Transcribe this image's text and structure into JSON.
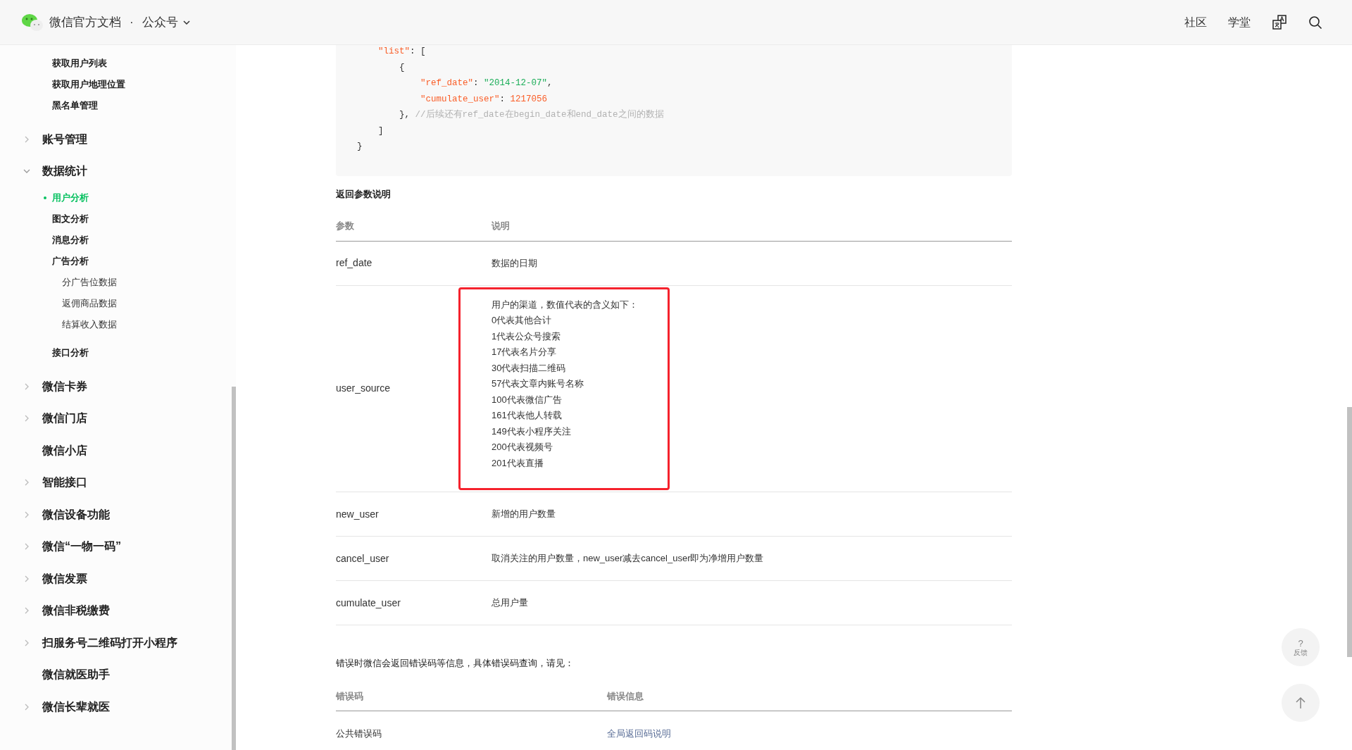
{
  "header": {
    "title": "微信官方文档",
    "separator": "·",
    "section": "公众号",
    "nav": [
      {
        "kind": "text",
        "label": "社区"
      },
      {
        "kind": "text",
        "label": "学堂"
      },
      {
        "kind": "translate"
      },
      {
        "kind": "search"
      }
    ]
  },
  "sidebar": {
    "items": [
      {
        "kind": "continued",
        "children": [
          {
            "label": "获取用户列表",
            "selected": false
          },
          {
            "label": "获取用户地理位置",
            "selected": false
          },
          {
            "label": "黑名单管理",
            "selected": false
          }
        ]
      },
      {
        "kind": "group",
        "label": "账号管理",
        "expanded": false
      },
      {
        "kind": "group",
        "label": "数据统计",
        "expanded": true,
        "children": [
          {
            "label": "用户分析",
            "selected": true
          },
          {
            "label": "图文分析",
            "selected": false
          },
          {
            "label": "消息分析",
            "selected": false
          },
          {
            "label": "广告分析",
            "selected": false,
            "children": [
              {
                "label": "分广告位数据"
              },
              {
                "label": "返佣商品数据"
              },
              {
                "label": "结算收入数据"
              }
            ]
          },
          {
            "label": "接口分析",
            "selected": false
          }
        ]
      },
      {
        "kind": "group",
        "label": "微信卡券",
        "expanded": false
      },
      {
        "kind": "group",
        "label": "微信门店",
        "expanded": false
      },
      {
        "kind": "link",
        "label": "微信小店"
      },
      {
        "kind": "group",
        "label": "智能接口",
        "expanded": false
      },
      {
        "kind": "group",
        "label": "微信设备功能",
        "expanded": false
      },
      {
        "kind": "group",
        "label": "微信“一物一码”",
        "expanded": false
      },
      {
        "kind": "group",
        "label": "微信发票",
        "expanded": false
      },
      {
        "kind": "group",
        "label": "微信非税缴费",
        "expanded": false
      },
      {
        "kind": "group",
        "label": "扫服务号二维码打开小程序",
        "expanded": false
      },
      {
        "kind": "link",
        "label": "微信就医助手"
      },
      {
        "kind": "group",
        "label": "微信长辈就医",
        "expanded": false
      }
    ]
  },
  "code": {
    "lines": [
      [
        {
          "kind": "key",
          "text": "    \"list\""
        },
        {
          "kind": "plain",
          "text": ": ["
        }
      ],
      [
        {
          "kind": "plain",
          "text": "        {"
        }
      ],
      [
        {
          "kind": "key",
          "text": "            \"ref_date\""
        },
        {
          "kind": "plain",
          "text": ": "
        },
        {
          "kind": "string",
          "text": "\"2014-12-07\""
        },
        {
          "kind": "plain",
          "text": ","
        }
      ],
      [
        {
          "kind": "key",
          "text": "            \"cumulate_user\""
        },
        {
          "kind": "plain",
          "text": ": "
        },
        {
          "kind": "number",
          "text": "1217056"
        }
      ],
      [
        {
          "kind": "plain",
          "text": "        }, "
        },
        {
          "kind": "comment",
          "text": "//后续还有ref_date在begin_date和end_date之间的数据"
        }
      ],
      [
        {
          "kind": "plain",
          "text": "    ]"
        }
      ],
      [
        {
          "kind": "plain",
          "text": "}"
        }
      ]
    ]
  },
  "return_params": {
    "title": "返回参数说明",
    "columns": [
      "参数",
      "说明"
    ],
    "rows": [
      {
        "param": "ref_date",
        "highlighted": false,
        "description": [
          "数据的日期"
        ]
      },
      {
        "param": "user_source",
        "highlighted": true,
        "description": [
          "用户的渠道，数值代表的含义如下：",
          "0代表其他合计",
          "1代表公众号搜索",
          "17代表名片分享",
          "30代表扫描二维码",
          "57代表文章内账号名称",
          "100代表微信广告",
          "161代表他人转载",
          "149代表小程序关注",
          "200代表视频号",
          "201代表直播"
        ]
      },
      {
        "param": "new_user",
        "highlighted": false,
        "description": [
          "新增的用户数量"
        ]
      },
      {
        "param": "cancel_user",
        "highlighted": false,
        "description": [
          "取消关注的用户数量，new_user减去cancel_user即为净增用户数量"
        ]
      },
      {
        "param": "cumulate_user",
        "highlighted": false,
        "description": [
          "总用户量"
        ]
      }
    ]
  },
  "errors": {
    "intro": "错误时微信会返回错误码等信息，具体错误码查询，请见：",
    "columns": [
      "错误码",
      "错误信息"
    ],
    "rows": [
      {
        "code": "公共错误码",
        "info": "全局返回码说明",
        "kind": "link"
      }
    ]
  },
  "floating": {
    "feedback_mark": "?",
    "feedback_label": "反馈"
  }
}
